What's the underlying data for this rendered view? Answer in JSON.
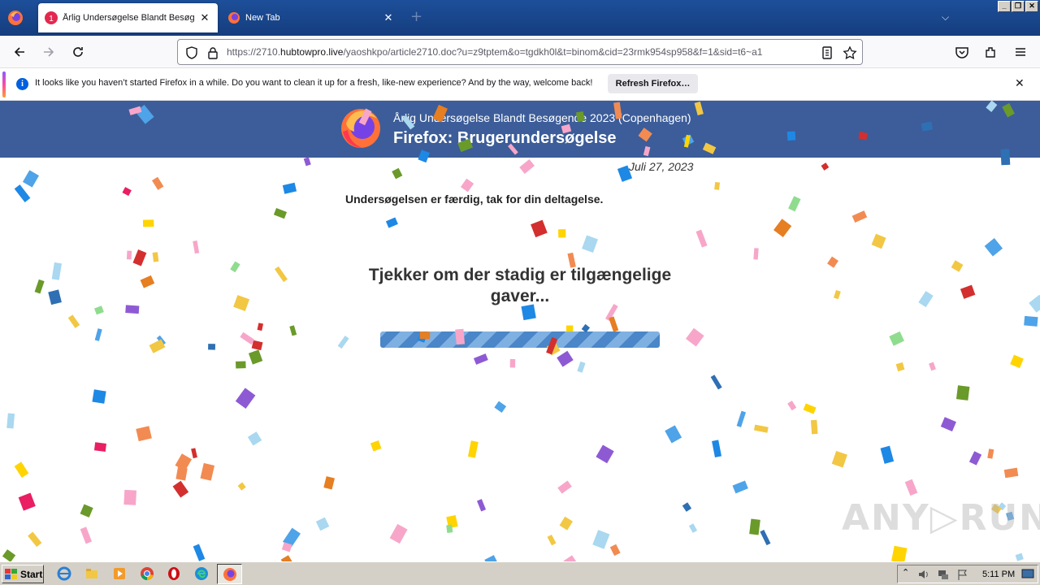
{
  "browser": {
    "tabs": [
      {
        "title": "Årlig Undersøgelse Blandt Besøgende",
        "badge": "1",
        "active": true
      },
      {
        "title": "New Tab",
        "active": false
      }
    ],
    "url": {
      "prefix": "https://2710.",
      "domain": "hubtowpro.live",
      "path": "/yaoshkpo/article2710.doc?u=z9tptem&o=tgdkh0l&t=binom&cid=23rmk954sp958&f=1&sid=t6~a1"
    },
    "notification": {
      "message": "It looks like you haven’t started Firefox in a while. Do you want to clean it up for a fresh, like-new experience? And by the way, welcome back!",
      "button": "Refresh Firefox…",
      "info_icon": "i"
    },
    "window_buttons": [
      "_",
      "❐",
      "✕"
    ]
  },
  "page": {
    "subtitle": "Årlig Undersøgelse Blandt Besøgende 2023 (Copenhagen)",
    "title": "Firefox: Brugerundersøgelse",
    "date": "Juli 27, 2023",
    "done_text": "Undersøgelsen er færdig, tak for din deltagelse.",
    "checking_text": "Tjekker om der stadig er tilgængelige gaver...",
    "watermark": "ANY▷RUN"
  },
  "taskbar": {
    "start_label": "Start",
    "clock": "5:11 PM"
  },
  "colors": {
    "banner": "#3c5d99",
    "titlebar": "#1d4f9a",
    "progress": "#4a86c8"
  }
}
